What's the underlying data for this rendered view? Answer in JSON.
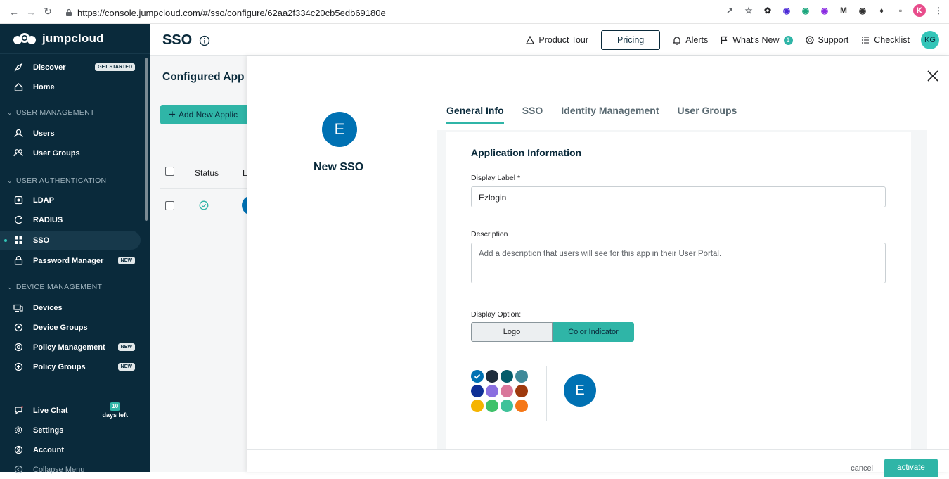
{
  "browser": {
    "url": "https://console.jumpcloud.com/#/sso/configure/62aa2f334c20cb5edb69180e",
    "profile_initial": "K"
  },
  "sidebar": {
    "brand": "jumpcloud",
    "items": [
      {
        "label": "Discover",
        "badge": "GET STARTED"
      },
      {
        "label": "Home"
      },
      {
        "section": "USER MANAGEMENT"
      },
      {
        "label": "Users"
      },
      {
        "label": "User Groups"
      },
      {
        "section": "USER AUTHENTICATION"
      },
      {
        "label": "LDAP"
      },
      {
        "label": "RADIUS"
      },
      {
        "label": "SSO"
      },
      {
        "label": "Password Manager",
        "badge": "NEW"
      },
      {
        "section": "DEVICE MANAGEMENT"
      },
      {
        "label": "Devices"
      },
      {
        "label": "Device Groups"
      },
      {
        "label": "Policy Management",
        "badge": "NEW"
      },
      {
        "label": "Policy Groups",
        "badge": "NEW"
      },
      {
        "label": "Live Chat",
        "days_num": "10",
        "days_text": "days left"
      },
      {
        "label": "Settings"
      },
      {
        "label": "Account"
      },
      {
        "label": "Collapse Menu"
      }
    ]
  },
  "header": {
    "title": "SSO",
    "product_tour": "Product Tour",
    "pricing": "Pricing",
    "alerts": "Alerts",
    "whats_new": "What's New",
    "whats_new_count": "1",
    "support": "Support",
    "checklist": "Checklist",
    "avatar": "KG"
  },
  "background": {
    "title": "Configured App",
    "add_button": "Add New Applic",
    "col_status": "Status",
    "col_l": "L"
  },
  "modal": {
    "app_initial": "E",
    "app_name": "New SSO",
    "tabs": [
      "General Info",
      "SSO",
      "Identity Management",
      "User Groups"
    ],
    "active_tab": "General Info",
    "section_title": "Application Information",
    "display_label_label": "Display Label *",
    "display_label_value": "Ezlogin",
    "description_label": "Description",
    "description_placeholder": "Add a description that users will see for this app in their User Portal.",
    "display_option_label": "Display Option:",
    "option_logo": "Logo",
    "option_color": "Color Indicator",
    "selected_option": "Color Indicator",
    "swatch_colors": [
      "#0071b3",
      "#1f2d3d",
      "#045d6b",
      "#3f8a99",
      "#0e2f96",
      "#8a6fe0",
      "#d9779b",
      "#9e3a0e",
      "#f5b400",
      "#3fc16a",
      "#3fc29a",
      "#f57717"
    ],
    "selected_swatch": "#0071b3",
    "preview_initial": "E",
    "cancel": "cancel",
    "activate": "activate"
  },
  "colors": {
    "sidebar_bg": "#0a2a3b",
    "accent": "#2fb5a7",
    "app_blue": "#0071b3"
  }
}
